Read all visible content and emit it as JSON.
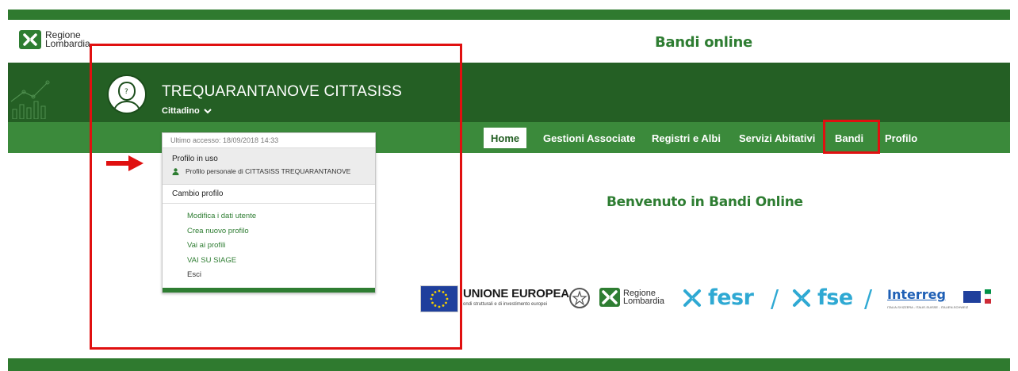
{
  "header": {
    "logo_line1": "Regione",
    "logo_line2": "Lombardia",
    "site_title": "Bandi online"
  },
  "user": {
    "name": "TREQUARANTANOVE CITTASISS",
    "role": "Cittadino"
  },
  "nav": {
    "items": [
      {
        "label": "Home",
        "active": true
      },
      {
        "label": "Gestioni Associate",
        "active": false
      },
      {
        "label": "Registri e Albi",
        "active": false
      },
      {
        "label": "Servizi Abitativi",
        "active": false
      },
      {
        "label": "Bandi",
        "active": false
      },
      {
        "label": "Profilo",
        "active": false
      }
    ]
  },
  "dropdown": {
    "last_access": "Ultimo accesso: 18/09/2018 14:33",
    "current_profile_title": "Profilo in uso",
    "current_profile_name": "Profilo personale di CITTASISS TREQUARANTANOVE",
    "change_profile": "Cambio profilo",
    "links": [
      "Modifica i dati utente",
      "Crea nuovo profilo",
      "Vai ai profili",
      "VAI SU SIAGE",
      "Esci"
    ]
  },
  "main": {
    "welcome": "Benvenuto in Bandi Online"
  },
  "sponsors": {
    "eu_title": "UNIONE EUROPEA",
    "eu_subtitle": "ondi strutturali e di investimento europei",
    "rl_line1": "Regione",
    "rl_line2": "Lombardia",
    "fesr": "fesr",
    "fse": "fse",
    "slash": "/",
    "interreg": "Interreg",
    "interreg_sub": "ITALIA-SVIZZERA - ITALIE-SUISSE - ITALIEN-SCHWEIZ"
  },
  "colors": {
    "brand_green": "#2e7d32",
    "hero_green": "#245f24",
    "nav_green": "#3b8a3b",
    "annotation_red": "#e01010",
    "fund_blue": "#2fa9d3"
  }
}
